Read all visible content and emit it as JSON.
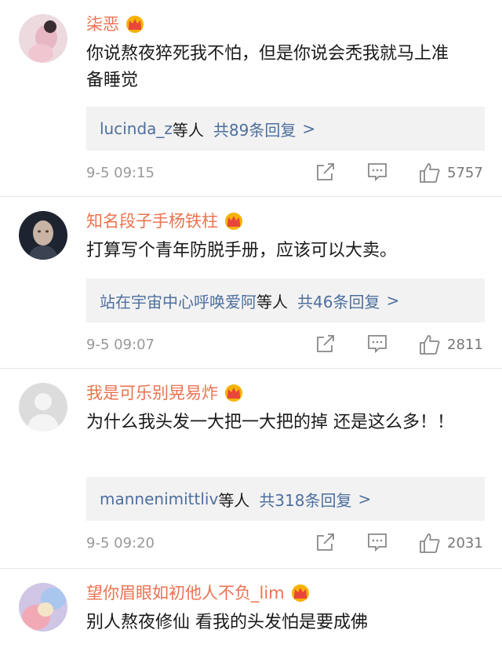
{
  "colors": {
    "username": "#eb7350",
    "link": "#4d6f9e",
    "reply_bg": "#f2f2f2",
    "meta_gray": "#999999",
    "crown_gold": "#f6b300"
  },
  "icons": {
    "crown": "vip-crown-icon",
    "share": "share-icon",
    "comment": "comment-icon",
    "like": "thumbs-up-icon"
  },
  "comments": [
    {
      "username": "柒恶",
      "text": "你说熬夜猝死我不怕，但是你说会秃我就马上准备睡觉",
      "reply_users": "lucinda_z",
      "reply_suffix": "等人",
      "reply_count": "共89条回复",
      "reply_chevron": ">",
      "time": "9-5 09:15",
      "likes": "5757"
    },
    {
      "username": "知名段子手杨铁柱",
      "text": "打算写个青年防脱手册，应该可以大卖。",
      "reply_users": "站在宇宙中心呼唤爱阿",
      "reply_suffix": "等人",
      "reply_count": "共46条回复",
      "reply_chevron": ">",
      "time": "9-5 09:07",
      "likes": "2811"
    },
    {
      "username": "我是可乐别晃易炸",
      "text": "为什么我头发一大把一大把的掉 还是这么多！！",
      "reply_users": "mannenimittliv",
      "reply_suffix": "等人",
      "reply_count": "共318条回复",
      "reply_chevron": ">",
      "time": "9-5 09:20",
      "likes": "2031"
    },
    {
      "username": "望你眉眼如初他人不负_lim",
      "text": "别人熬夜修仙 看我的头发怕是要成佛"
    }
  ]
}
